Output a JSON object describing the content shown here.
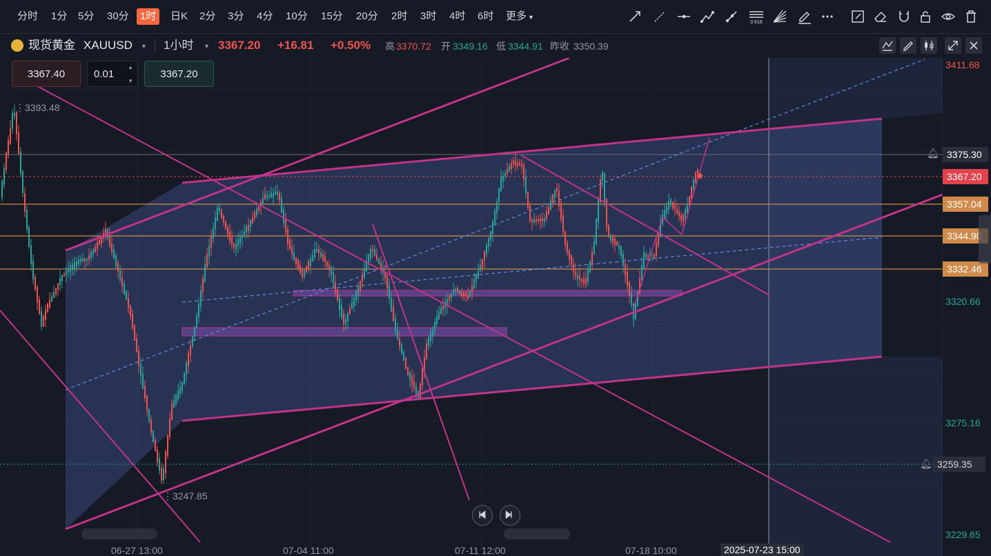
{
  "toolbar": {
    "timeframes": [
      "分时",
      "1分",
      "5分",
      "30分",
      "1时",
      "日K",
      "2分",
      "3分",
      "4分",
      "10分",
      "15分",
      "20分",
      "2时",
      "3时",
      "4时",
      "6时",
      "更多"
    ],
    "active_timeframe": "1时",
    "tools": [
      "trend-line-icon",
      "dashed-line-icon",
      "horizontal-line-icon",
      "polyline-icon",
      "ray-icon",
      "fibonacci-icon",
      "gann-fan-icon",
      "brush-icon",
      "more-icon",
      "edit-icon",
      "eraser-icon",
      "magnet-icon",
      "lock-icon",
      "eye-icon",
      "trash-icon"
    ],
    "fib_badge": "0.618"
  },
  "symbol": {
    "name": "现货黄金",
    "code": "XAUUSD",
    "interval": "1小时",
    "price": "3367.20",
    "change": "+16.81",
    "change_pct": "+0.50%",
    "high_label": "高",
    "high": "3370.72",
    "open_label": "开",
    "open": "3349.16",
    "low_label": "低",
    "low": "3344.91",
    "prev_close_label": "昨收",
    "prev_close": "3350.39"
  },
  "order": {
    "sell_price": "3367.40",
    "quantity": "0.01",
    "buy_price": "3367.20"
  },
  "price_axis": {
    "ticks": [
      "3411.68",
      "3320.66",
      "3275.16",
      "3229.65"
    ],
    "markers": [
      {
        "value": "3375.30",
        "bg": "#2a2e39",
        "fg": "#ffffff"
      },
      {
        "value": "3367.20",
        "bg": "#e3424c",
        "fg": "#ffffff"
      },
      {
        "value": "3357.04",
        "bg": "#d08a4a",
        "fg": "#ffffff"
      },
      {
        "value": "3344.90",
        "bg": "#d08a4a",
        "fg": "#ffffff"
      },
      {
        "value": "3332.46",
        "bg": "#d08a4a",
        "fg": "#ffffff"
      },
      {
        "value": "3259.35",
        "bg": "#2a2e39",
        "fg": "#d1d4dc"
      }
    ]
  },
  "annotations": {
    "high_mark": "3393.48",
    "low_mark": "3247.85"
  },
  "time_axis": {
    "labels": [
      "06-27 13:00",
      "07-04 11:00",
      "07-11 12:00",
      "07-18 10:00"
    ],
    "crosshair_label": "2025-07-23 15:00"
  },
  "colors": {
    "up": "#26a69a",
    "down": "#ef5350",
    "channel": "#c2338a",
    "accent": "#f5673f",
    "level": "#d08a4a"
  }
}
